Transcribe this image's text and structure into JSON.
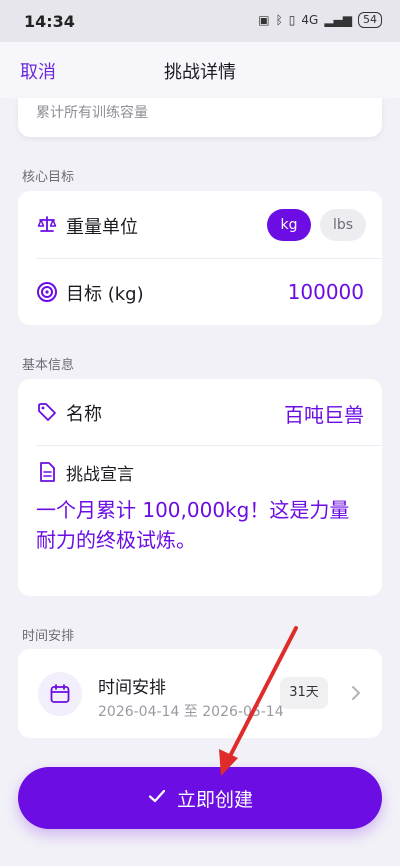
{
  "status_bar": {
    "time": "14:34",
    "network": "4G",
    "battery": "54"
  },
  "nav": {
    "cancel": "取消",
    "title": "挑战详情"
  },
  "description_card": {
    "placeholder": "累计所有训练容量"
  },
  "core_goal": {
    "section_label": "核心目标",
    "weight_unit_label": "重量单位",
    "unit_options": [
      "kg",
      "lbs"
    ],
    "selected_unit": "kg",
    "goal_label": "目标 (kg)",
    "goal_value": "100000"
  },
  "basic_info": {
    "section_label": "基本信息",
    "name_label": "名称",
    "name_value": "百吨巨兽",
    "declaration_label": "挑战宣言",
    "declaration_value": "一个月累计 100,000kg！这是力量耐力的终极试炼。"
  },
  "schedule": {
    "section_label": "时间安排",
    "title": "时间安排",
    "range": "2026-04-14 至 2026-05-14",
    "days": "31天"
  },
  "actions": {
    "create": "立即创建"
  },
  "colors": {
    "accent": "#6b0de3",
    "annotation_arrow": "#e02b2b"
  },
  "icons": {
    "weight_unit": "balance-scale-icon",
    "goal": "target-icon",
    "name": "tag-icon",
    "declaration": "document-icon",
    "schedule": "calendar-icon",
    "chevron": "chevron-right-icon",
    "create": "checkmark-icon"
  }
}
